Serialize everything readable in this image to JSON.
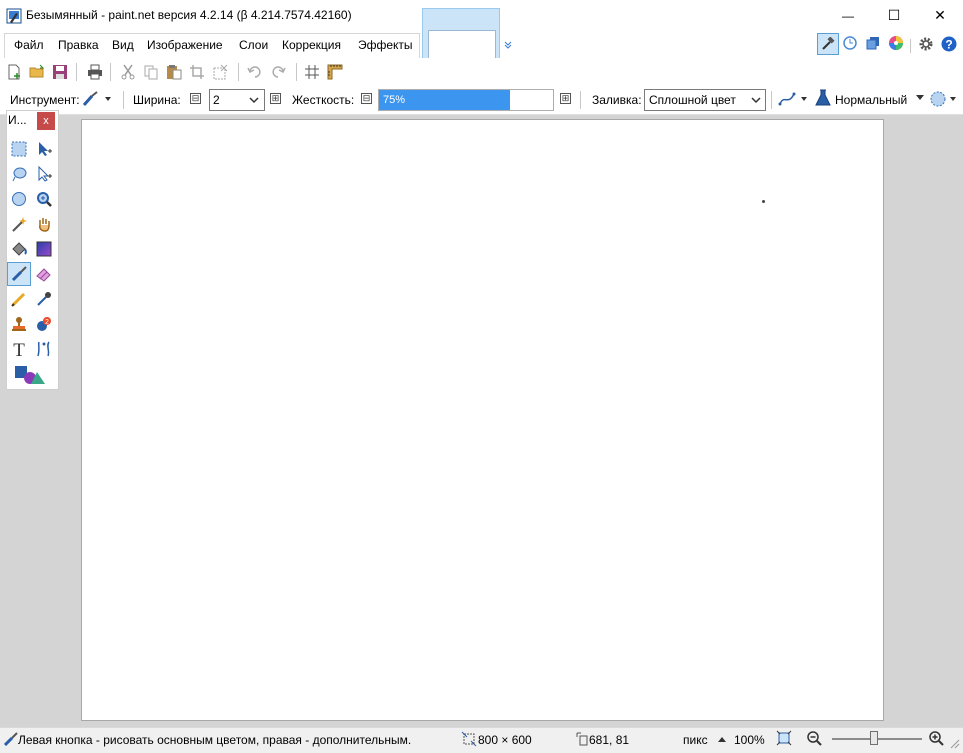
{
  "window": {
    "title": "Безымянный - paint.net версия 4.2.14 (β 4.214.7574.42160)",
    "minimize_glyph": "—",
    "maximize_glyph": "☐",
    "close_glyph": "✕"
  },
  "menu": {
    "items": [
      "Файл",
      "Правка",
      "Вид",
      "Изображение",
      "Слои",
      "Коррекция",
      "Эффекты"
    ]
  },
  "toolbar_options": {
    "tool_label": "Инструмент:",
    "width_label": "Ширина:",
    "width_value": "2",
    "hardness_label": "Жесткость:",
    "hardness_value": "75%",
    "hardness_fraction": 0.75,
    "fill_label": "Заливка:",
    "fill_value": "Сплошной цвет",
    "blend_mode": "Нормальный",
    "minus": "⊟",
    "plus": "⊞"
  },
  "tools_window": {
    "title": "И...",
    "close": "x",
    "selected_tool": "paintbrush",
    "icons": [
      "rectangle-select-icon",
      "move-selection-icon",
      "lasso-select-icon",
      "move-selected-icon",
      "ellipse-select-icon",
      "zoom-icon",
      "magic-wand-icon",
      "pan-icon",
      "paint-bucket-icon",
      "gradient-icon",
      "paintbrush-icon",
      "eraser-icon",
      "pencil-icon",
      "color-picker-icon",
      "clone-stamp-icon",
      "recolor-icon",
      "text-icon",
      "line-curve-icon",
      "shapes-icon"
    ]
  },
  "statusbar": {
    "hint": "Левая кнопка - рисовать основным цветом, правая - дополнительным.",
    "image_size": "800 × 600",
    "cursor_pos": "681, 81",
    "units": "пикс",
    "zoom": "100%"
  },
  "colors": {
    "accent": "#3c96ef",
    "selected_bg": "#cce4f7",
    "close_red": "#c74a4a"
  }
}
